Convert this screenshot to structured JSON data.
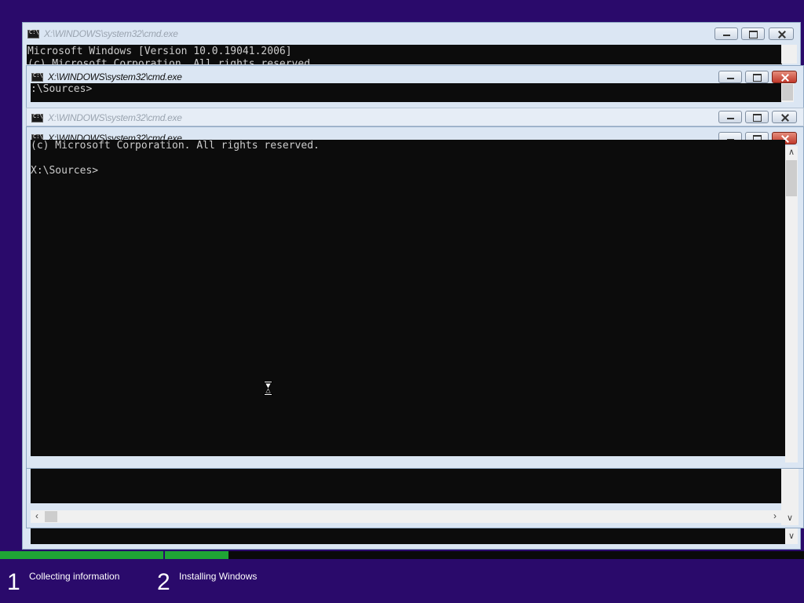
{
  "windows": [
    {
      "title": "X:\\WINDOWS\\system32\\cmd.exe",
      "lines": [
        "Microsoft Windows [Version 10.0.19041.2006]",
        "(c) Microsoft Corporation. All rights reserved."
      ]
    },
    {
      "title": "X:\\WINDOWS\\system32\\cmd.exe",
      "lines": [
        ":\\Sources>"
      ]
    },
    {
      "title": "X:\\WINDOWS\\system32\\cmd.exe",
      "lines": []
    },
    {
      "title": "X:\\WINDOWS\\system32\\cmd.exe",
      "lines": [
        "(c) Microsoft Corporation. All rights reserved.",
        "",
        "X:\\Sources>"
      ]
    }
  ],
  "setup": {
    "steps": [
      {
        "number": "1",
        "label": "Collecting information"
      },
      {
        "number": "2",
        "label": "Installing Windows"
      }
    ],
    "progress": {
      "step1": 1.0,
      "step2": 0.1
    }
  },
  "icons": {
    "app": "cmd-icon",
    "minimize": "minimize-icon",
    "maximize": "maximize-icon",
    "close": "close-icon",
    "busy": "hourglass-cursor-icon"
  },
  "colors": {
    "desktop": "#2a0a6b",
    "console_bg": "#0c0c0c",
    "console_fg": "#cccccc",
    "progress": "#1fa535",
    "close_active": "#c0392b"
  }
}
